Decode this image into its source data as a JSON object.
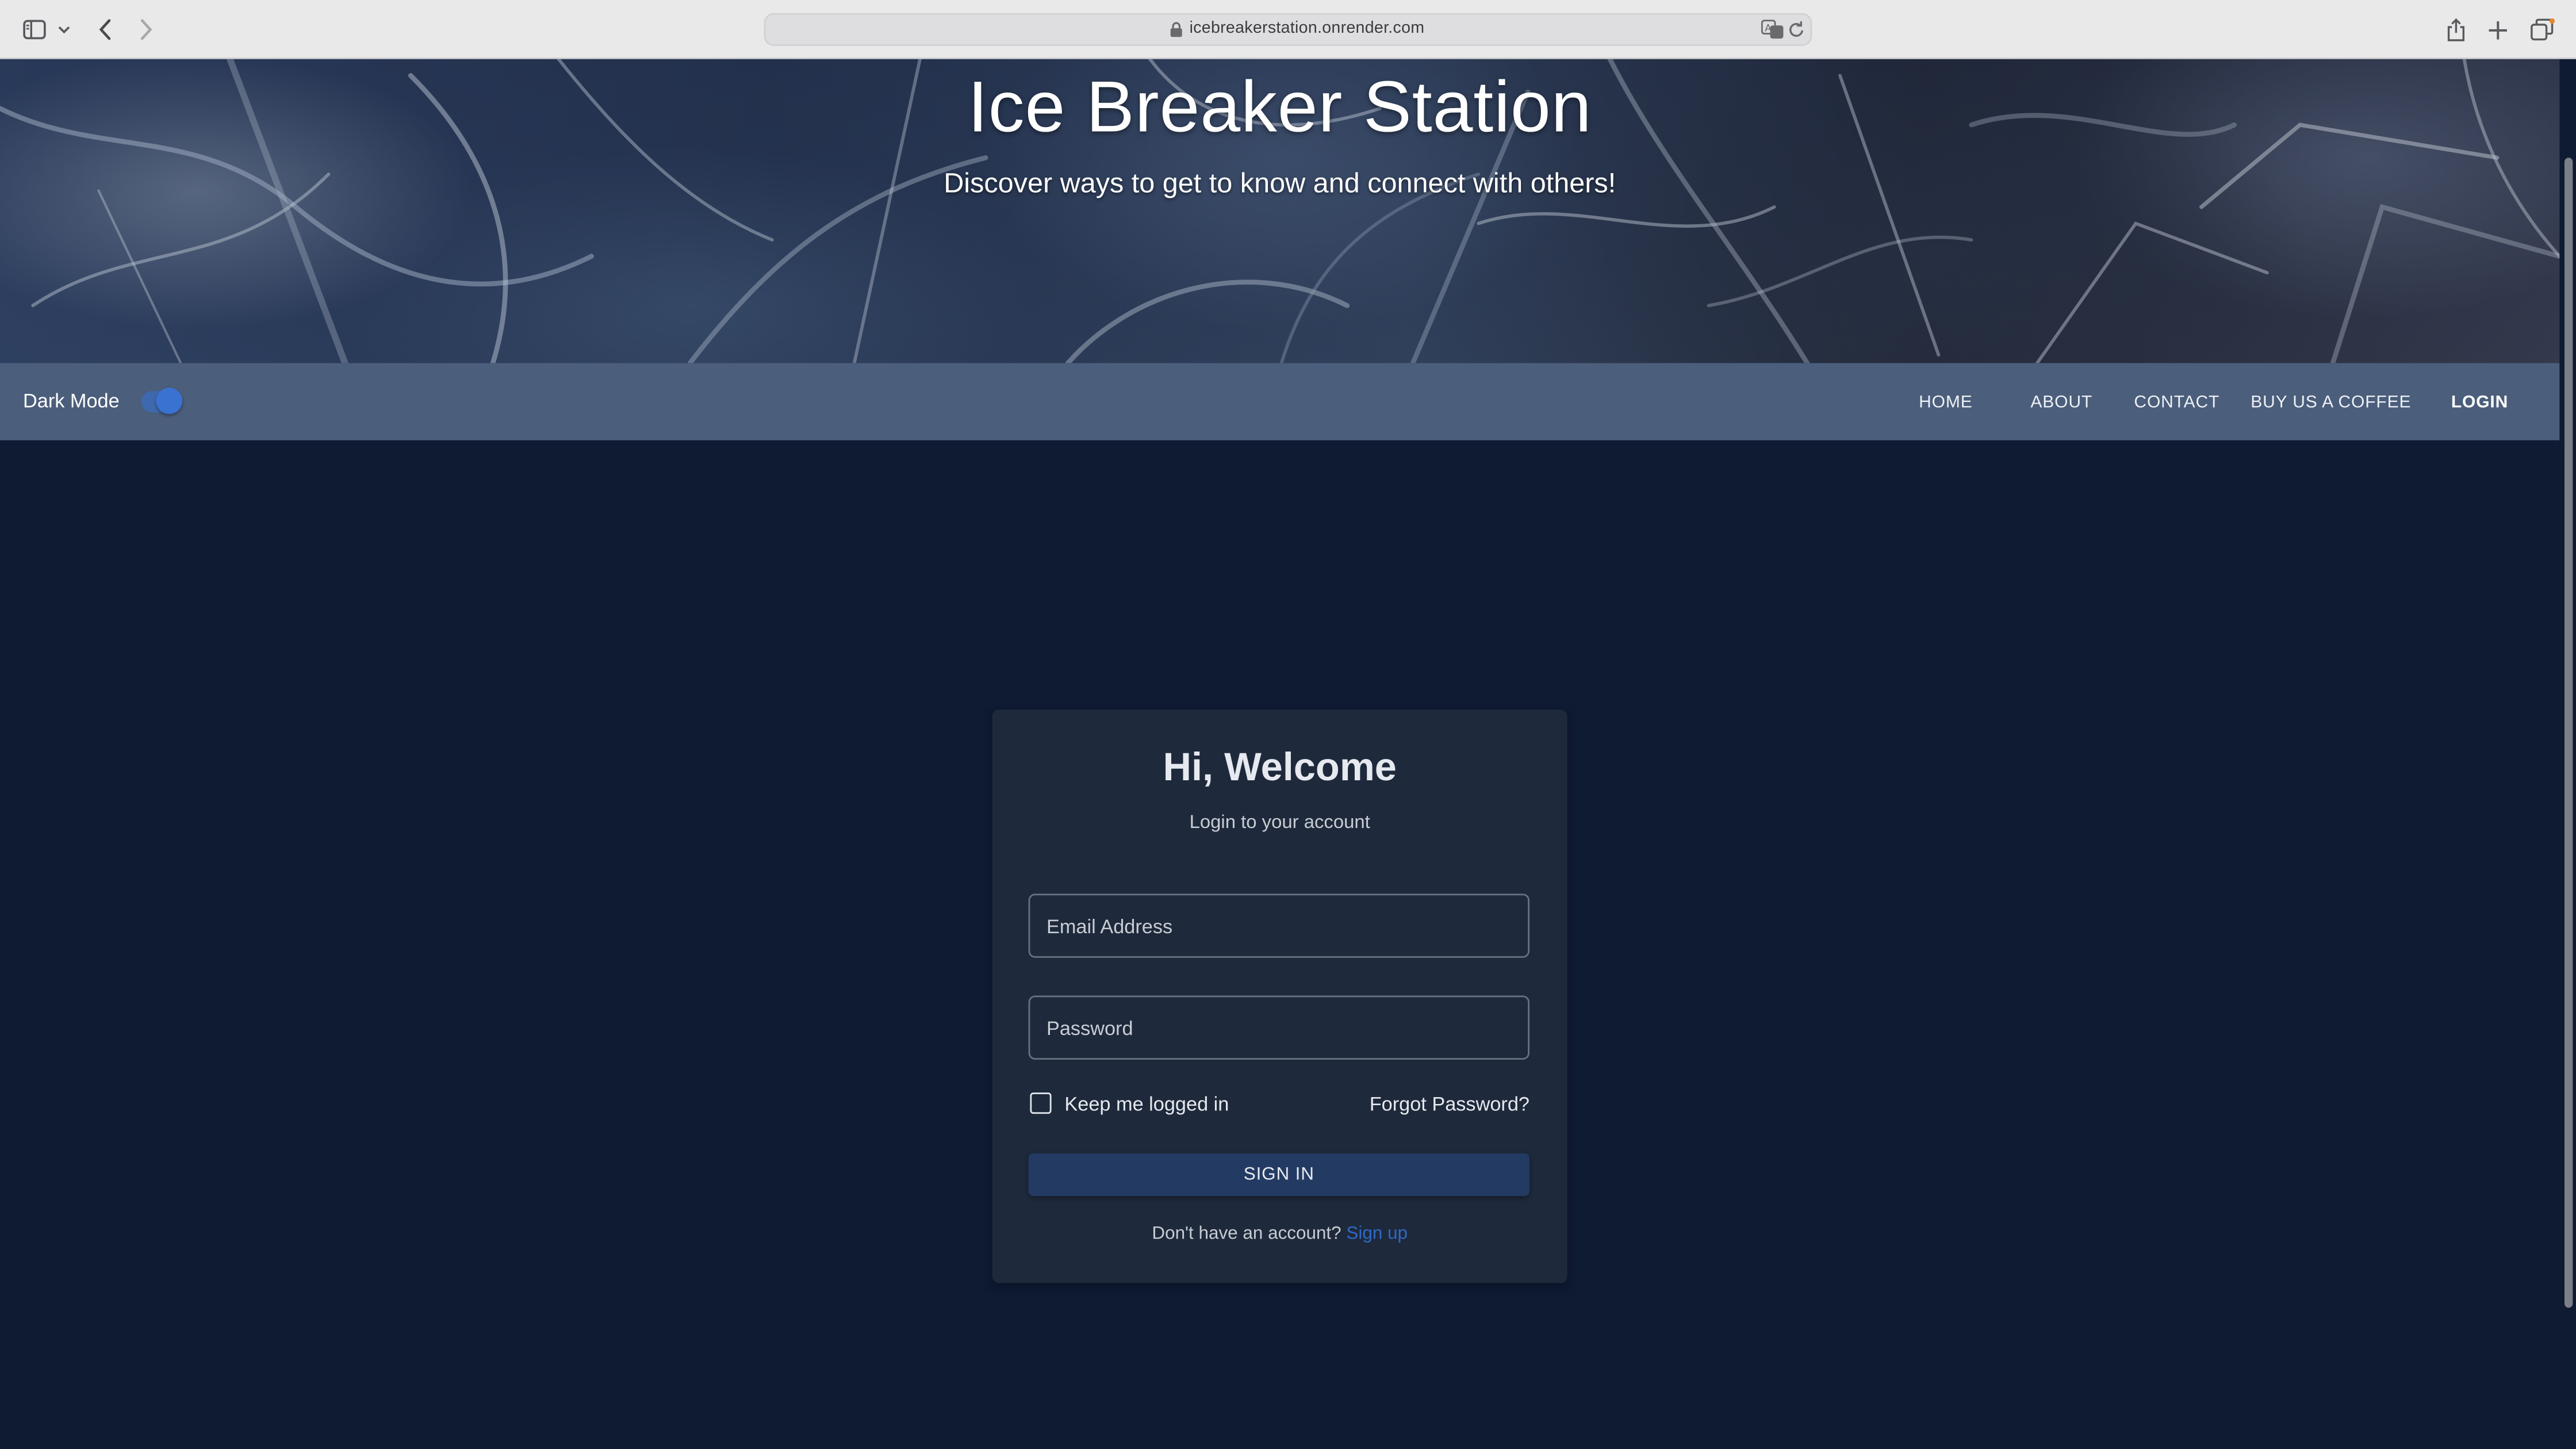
{
  "browser": {
    "url": "icebreakerstation.onrender.com"
  },
  "hero": {
    "title": "Ice Breaker Station",
    "subtitle": "Discover ways to get to know and connect with others!"
  },
  "nav": {
    "dark_mode_label": "Dark Mode",
    "dark_mode_on": true,
    "links": [
      "HOME",
      "ABOUT",
      "CONTACT",
      "BUY US A COFFEE",
      "LOGIN"
    ],
    "active": "LOGIN"
  },
  "login": {
    "title": "Hi, Welcome",
    "subtitle": "Login to your account",
    "email_placeholder": "Email Address",
    "password_placeholder": "Password",
    "keep_logged_in": "Keep me logged in",
    "forgot_password": "Forgot Password?",
    "sign_in": "SIGN IN",
    "no_account": "Don't have an account?",
    "sign_up": "Sign up"
  },
  "colors": {
    "page_bg": "#0f1a33",
    "navbar_bg": "#4b5e7b",
    "card_bg": "#1e293b",
    "button_bg": "#233b63",
    "link": "#2f69c4",
    "toggle": "#3a72d1"
  }
}
